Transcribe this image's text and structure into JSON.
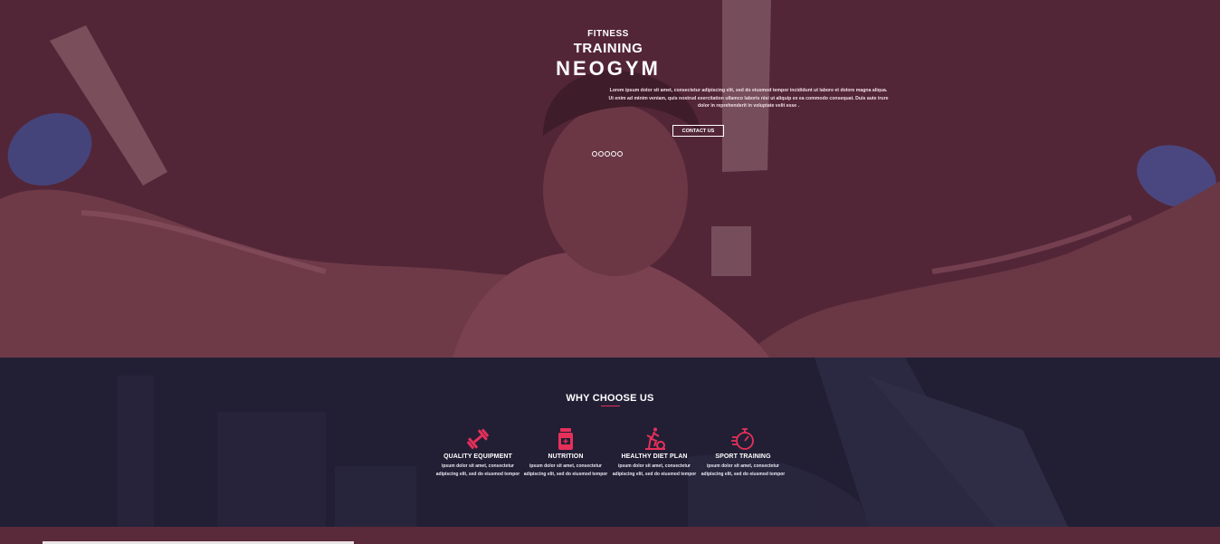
{
  "hero": {
    "eyebrow": "FITNESS",
    "subtitle": "TRAINING",
    "title": "NEOGYM",
    "lead": "Lorem ipsum dolor sit amet, consectetur adipiscing elit, sed do eiusmod tempor incididunt ut labore et dolore magna aliqua. Ut enim ad minim veniam, quis nostrud exercitation ullamco laboris nisi ut aliquip ex ea commodo consequat. Duis aute irure dolor in reprehenderit in voluptate velit esse .",
    "cta_label": "CONTACT US",
    "slide_count": 5,
    "overlay_color": "#532637"
  },
  "why": {
    "title": "WHY CHOOSE US",
    "accent_color": "#e6305a",
    "features": [
      {
        "icon": "dumbbell-icon",
        "name": "QUALITY EQUIPMENT",
        "desc": "ipsum dolor sit amet, consectetur adipiscing elit, sed do eiusmod tempor"
      },
      {
        "icon": "supplement-jar-icon",
        "name": "NUTRITION",
        "desc": "ipsum dolor sit amet, consectetur adipiscing elit, sed do eiusmod tempor"
      },
      {
        "icon": "exercise-bike-icon",
        "name": "HEALTHY DIET PLAN",
        "desc": "ipsum dolor sit amet, consectetur adipiscing elit, sed do eiusmod tempor"
      },
      {
        "icon": "stopwatch-icon",
        "name": "SPORT TRAINING",
        "desc": "ipsum dolor sit amet, consectetur adipiscing elit, sed do eiusmod tempor"
      }
    ]
  }
}
